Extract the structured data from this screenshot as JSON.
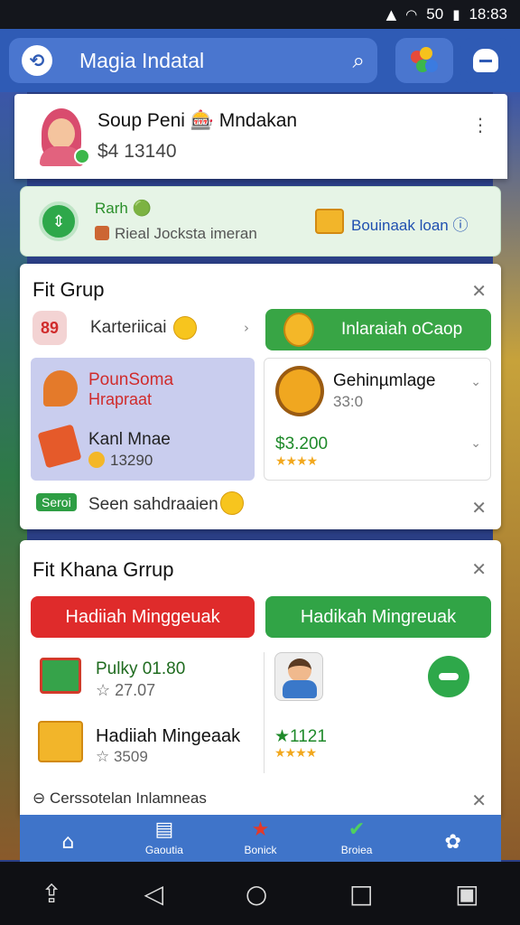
{
  "status_bar": {
    "time": "18:83",
    "signal_label": "50",
    "wifi_icon": "wifi-icon",
    "battery_icon": "battery-icon"
  },
  "app_bar": {
    "title": "Magia Indatal",
    "search_icon": "search-icon",
    "colors_icon": "palette-icon",
    "account_icon": "account-icon"
  },
  "profile": {
    "name": "Soup Peni 🎰 Mndakan",
    "balance": "$4 13140",
    "menu_icon": "kebab-icon"
  },
  "banner": {
    "line1": "Rarh 🟢",
    "line2": "Rieal Jocksta imeran",
    "cta": "Bouinaak loan ⓘ"
  },
  "fit_group": {
    "title": "Fit Grup",
    "category_badge": "89",
    "category_label": "Karteriicai",
    "promo_button": "Inlaraiah oCaop",
    "left_card": {
      "title": "PounSoma",
      "subtitle": "Hrapraat",
      "item_title": "Kanl Mnae",
      "item_value": "13290"
    },
    "right_card": {
      "title": "Gehinµmlage",
      "subtitle": "33:0",
      "price": "$3.200",
      "stars": "★★★★"
    },
    "footer_tag": "Seroi",
    "footer_text": "Seen sahdraaien"
  },
  "fit_khana_group": {
    "title": "Fit Khana Grrup",
    "red_button": "Hadiiah Minggeuak",
    "green_button": "Hadikah Mingreuak",
    "row1_title": "Pulky 01.80",
    "row1_sub": "☆ 27.07",
    "row2_title": "Hadiiah Mingeaak",
    "row2_sub": "☆ 3509",
    "row2_value": "★1121",
    "row2_stars": "★★★★",
    "hint": "⊖ Cerssotelan Inlamneas"
  },
  "bottom_nav": [
    {
      "label": "",
      "icon": "home-icon"
    },
    {
      "label": "Gaoutia",
      "icon": "cards-icon"
    },
    {
      "label": "Bonick",
      "icon": "star-icon"
    },
    {
      "label": "Broiea",
      "icon": "check-icon"
    },
    {
      "label": "",
      "icon": "settings-icon"
    }
  ],
  "colors": {
    "primary": "#2f5bb5",
    "green": "#31a446",
    "red": "#df2b2b",
    "lavender": "#c9cdee"
  }
}
